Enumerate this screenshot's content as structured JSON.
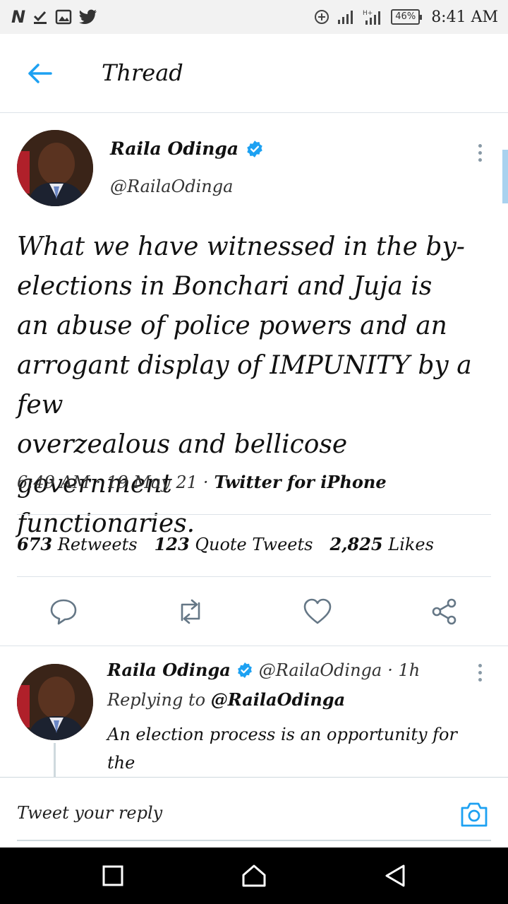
{
  "status_bar": {
    "battery": "46%",
    "time": "8:41 AM",
    "left_icons": [
      "n-icon",
      "check-download-icon",
      "image-icon",
      "twitter-bird-icon"
    ],
    "right_icons": [
      "data-saver-icon",
      "signal-icon",
      "signal-h-plus-icon",
      "battery-icon"
    ]
  },
  "header": {
    "title": "Thread"
  },
  "tweet": {
    "author_name": "Raila Odinga",
    "handle": "@RailaOdinga",
    "text": "What we have witnessed in the by-\nelections in Bonchari and Juja is\nan abuse of police powers and an\narrogant display of IMPUNITY by a few\noverzealous and bellicose government\nfunctionaries.",
    "time": "6:49 AM",
    "date": "19 May 21",
    "sep": "·",
    "source": "Twitter for iPhone",
    "stats": {
      "retweets_count": "673",
      "retweets_label": "Retweets",
      "quotes_count": "123",
      "quotes_label": "Quote Tweets",
      "likes_count": "2,825",
      "likes_label": "Likes"
    }
  },
  "reply": {
    "author_name": "Raila Odinga",
    "handle": "@RailaOdinga",
    "time": "· 1h",
    "replying_label": "Replying to",
    "replying_to": "@RailaOdinga",
    "text": "An election process is an opportunity for the\nvoters to express their will at the ballot and"
  },
  "compose": {
    "placeholder": "Tweet your reply"
  },
  "colors": {
    "accent": "#1da1f2",
    "icon_gray": "#657786",
    "divider": "#dde3e8"
  }
}
